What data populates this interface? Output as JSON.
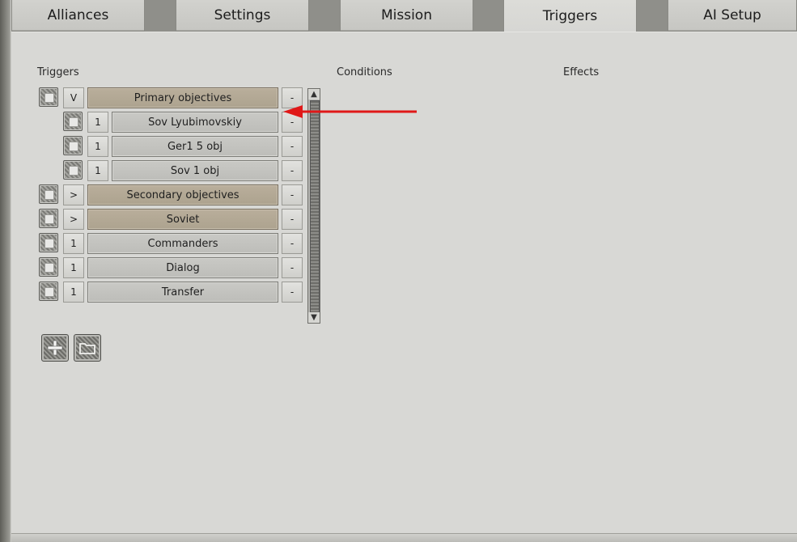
{
  "tabs": [
    {
      "label": "Alliances",
      "active": false
    },
    {
      "label": "Settings",
      "active": false
    },
    {
      "label": "Mission",
      "active": false
    },
    {
      "label": "Triggers",
      "active": true
    },
    {
      "label": "AI Setup",
      "active": false
    }
  ],
  "headings": {
    "triggers": "Triggers",
    "conditions": "Conditions",
    "effects": "Effects"
  },
  "triggers": [
    {
      "toggle": "V",
      "name": "Primary objectives",
      "folder": true,
      "indent": 0,
      "remove": "-"
    },
    {
      "toggle": "1",
      "name": "Sov Lyubimovskiy",
      "folder": false,
      "indent": 1,
      "remove": "-"
    },
    {
      "toggle": "1",
      "name": "Ger1 5 obj",
      "folder": false,
      "indent": 1,
      "remove": "-"
    },
    {
      "toggle": "1",
      "name": "Sov  1 obj",
      "folder": false,
      "indent": 1,
      "remove": "-"
    },
    {
      "toggle": ">",
      "name": "Secondary objectives",
      "folder": true,
      "indent": 0,
      "remove": "-"
    },
    {
      "toggle": ">",
      "name": "Soviet",
      "folder": true,
      "indent": 0,
      "remove": "-"
    },
    {
      "toggle": "1",
      "name": "Commanders",
      "folder": false,
      "indent": 0,
      "remove": "-"
    },
    {
      "toggle": "1",
      "name": "Dialog",
      "folder": false,
      "indent": 0,
      "remove": "-"
    },
    {
      "toggle": "1",
      "name": "Transfer",
      "folder": false,
      "indent": 0,
      "remove": "-"
    }
  ],
  "icons": {
    "add": "plus-icon",
    "folder": "folder-icon",
    "annotation": "red-arrow-icon",
    "scroll_up": "scroll-up-icon",
    "scroll_down": "scroll-down-icon"
  },
  "colors": {
    "folder_row": "#b3a895",
    "item_row": "#c3c3bf",
    "annotation_arrow": "#e01818",
    "panel": "#d8d8d5"
  }
}
